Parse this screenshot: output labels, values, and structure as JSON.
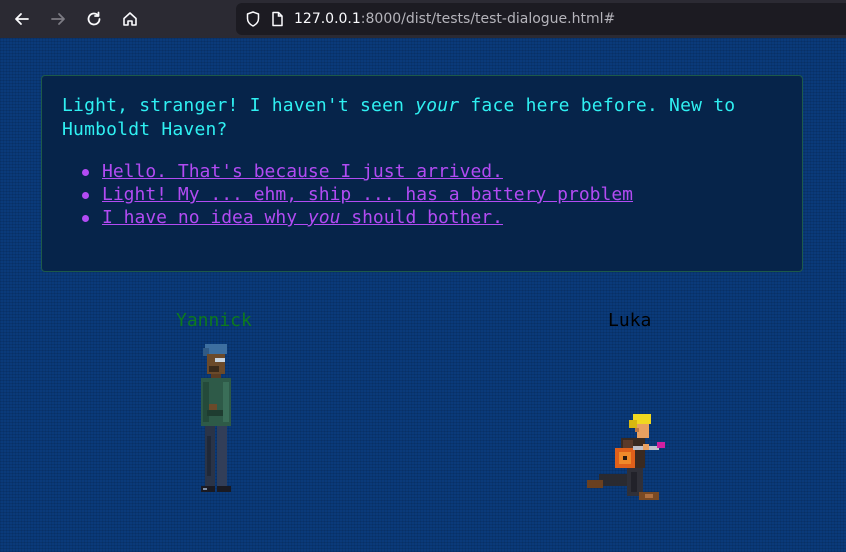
{
  "browser": {
    "back_icon": "arrow-left-icon",
    "forward_icon": "arrow-right-icon",
    "reload_icon": "reload-icon",
    "home_icon": "home-icon",
    "url_host": "127.0.0.1",
    "url_rest": ":8000/dist/tests/test-dialogue.html#"
  },
  "dialogue": {
    "line_part1": "Light, stranger! I haven't seen ",
    "line_emph": "your",
    "line_part2": " face here before. New to Humboldt Haven?",
    "choices": [
      {
        "text": "Hello. That's because I just arrived."
      },
      {
        "text": "Light! My ... ehm, ship ... has a battery problem"
      },
      {
        "text_before": "I have no idea why ",
        "text_emph": "you",
        "text_after": " should bother."
      }
    ]
  },
  "characters": {
    "yannick": {
      "name": "Yannick",
      "color": "#0d7a1d"
    },
    "luka": {
      "name": "Luka",
      "color": "#000000"
    }
  },
  "colors": {
    "background": "#0a3a7a",
    "dialogue_text": "#2ff0f2",
    "choice_text": "#b24bf3"
  }
}
